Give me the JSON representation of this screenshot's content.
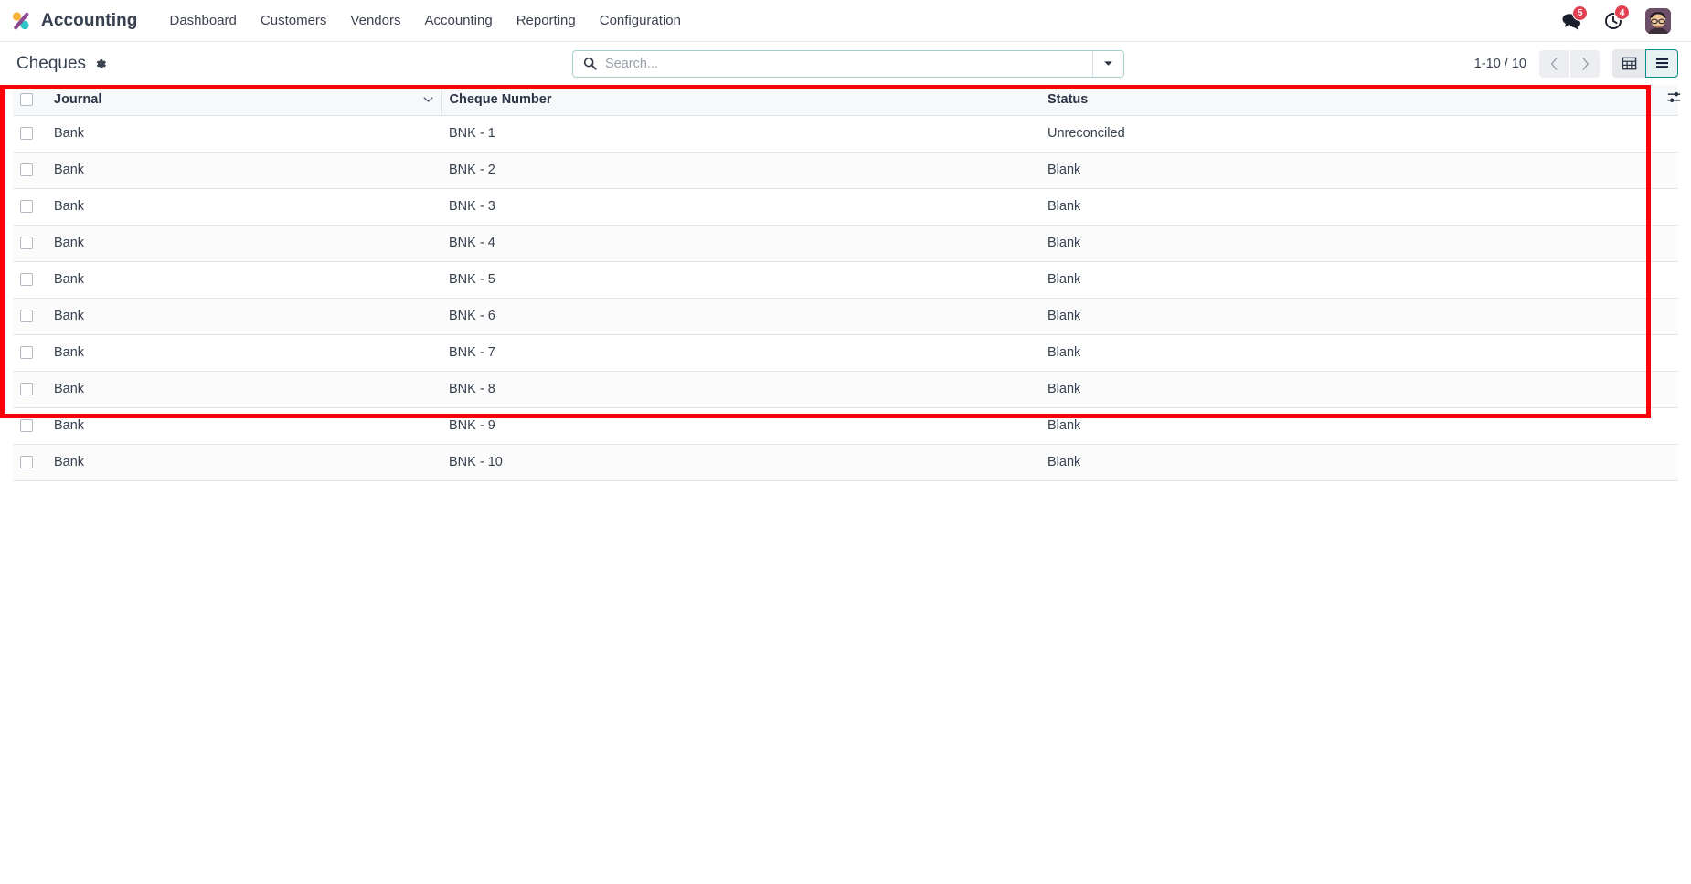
{
  "navbar": {
    "brand": "Accounting",
    "logo_icon": "odoo-logo-icon",
    "links": [
      {
        "label": "Dashboard"
      },
      {
        "label": "Customers"
      },
      {
        "label": "Vendors"
      },
      {
        "label": "Accounting"
      },
      {
        "label": "Reporting"
      },
      {
        "label": "Configuration"
      }
    ],
    "messages": {
      "icon": "chat-bubbles-icon",
      "count": "5"
    },
    "activities": {
      "icon": "clock-icon",
      "count": "4"
    },
    "avatar": {
      "icon": "user-avatar-icon"
    }
  },
  "control_panel": {
    "title": "Cheques",
    "settings_icon": "gear-icon",
    "search": {
      "icon": "search-icon",
      "value": "",
      "placeholder": "Search...",
      "toggle_icon": "chevron-down-icon"
    },
    "pager": {
      "count": "1-10 / 10",
      "prev_icon": "chevron-left-icon",
      "next_icon": "chevron-right-icon"
    },
    "views": [
      {
        "name": "pivot",
        "icon": "grid-table-icon",
        "active": false
      },
      {
        "name": "list",
        "icon": "list-icon",
        "active": true
      }
    ]
  },
  "list_view": {
    "optional_columns_icon": "sliders-icon",
    "select_all_checkbox": "checkbox-icon",
    "columns": [
      {
        "key": "journal",
        "label": "Journal",
        "sorted": true,
        "sort_icon": "chevron-down-icon"
      },
      {
        "key": "cheque_number",
        "label": "Cheque Number",
        "sorted": false
      },
      {
        "key": "status",
        "label": "Status",
        "sorted": false
      }
    ],
    "rows": [
      {
        "journal": "Bank",
        "cheque_number": "BNK - 1",
        "status": "Unreconciled"
      },
      {
        "journal": "Bank",
        "cheque_number": "BNK - 2",
        "status": "Blank"
      },
      {
        "journal": "Bank",
        "cheque_number": "BNK - 3",
        "status": "Blank"
      },
      {
        "journal": "Bank",
        "cheque_number": "BNK - 4",
        "status": "Blank"
      },
      {
        "journal": "Bank",
        "cheque_number": "BNK - 5",
        "status": "Blank"
      },
      {
        "journal": "Bank",
        "cheque_number": "BNK - 6",
        "status": "Blank"
      },
      {
        "journal": "Bank",
        "cheque_number": "BNK - 7",
        "status": "Blank"
      },
      {
        "journal": "Bank",
        "cheque_number": "BNK - 8",
        "status": "Blank"
      },
      {
        "journal": "Bank",
        "cheque_number": "BNK - 9",
        "status": "Blank"
      },
      {
        "journal": "Bank",
        "cheque_number": "BNK - 10",
        "status": "Blank"
      }
    ]
  },
  "annotation": {
    "highlight_color": "#fb0007"
  }
}
